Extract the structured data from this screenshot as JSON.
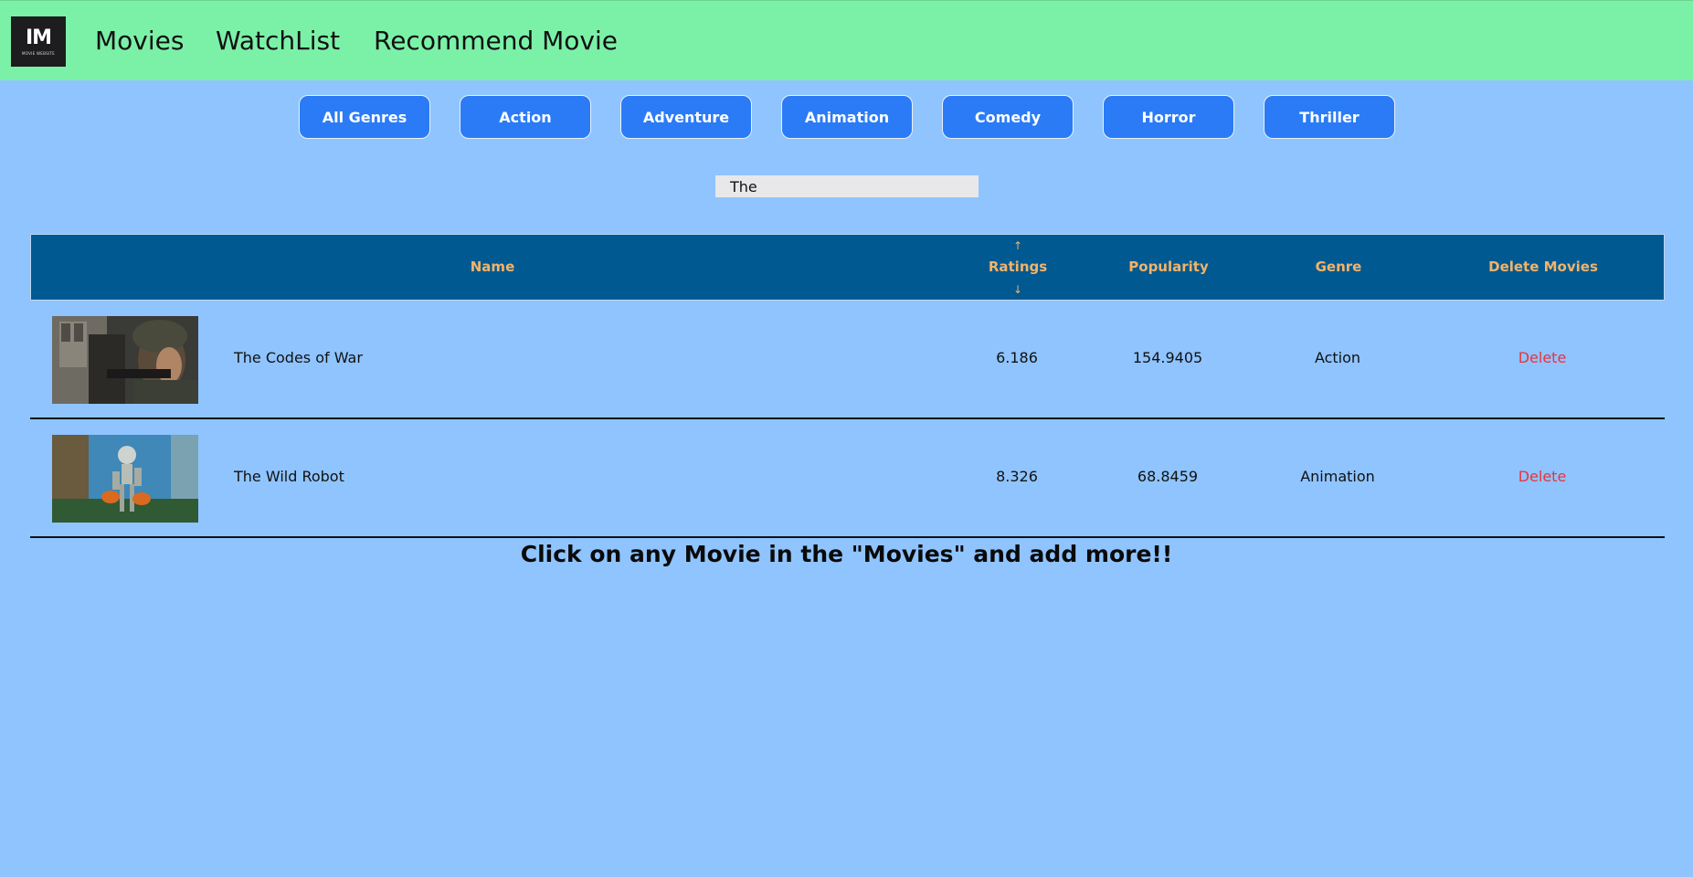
{
  "logo": {
    "main": "IM",
    "sub": "MOVIE WEBSITE"
  },
  "nav": {
    "movies": "Movies",
    "watchlist": "WatchList",
    "recommend": "Recommend Movie"
  },
  "genres": [
    "All Genres",
    "Action",
    "Adventure",
    "Animation",
    "Comedy",
    "Horror",
    "Thriller"
  ],
  "search": {
    "value": "The",
    "placeholder": ""
  },
  "table": {
    "headers": {
      "name": "Name",
      "ratings": "Ratings",
      "popularity": "Popularity",
      "genre": "Genre",
      "delete": "Delete Movies",
      "sort_up": "↑",
      "sort_down": "↓"
    },
    "rows": [
      {
        "name": "The Codes of War",
        "rating": "6.186",
        "popularity": "154.9405",
        "genre": "Action",
        "action": "Delete"
      },
      {
        "name": "The Wild Robot",
        "rating": "8.326",
        "popularity": "68.8459",
        "genre": "Animation",
        "action": "Delete"
      }
    ]
  },
  "footer": {
    "message": "Click on any Movie in the \"Movies\" and add more!!"
  },
  "colors": {
    "background": "#8fc4ff",
    "navbar": "#7bf1a8",
    "button": "#2b7bf6",
    "table_header": "#005990",
    "header_text": "#f2b36a",
    "delete": "#e8343d"
  }
}
